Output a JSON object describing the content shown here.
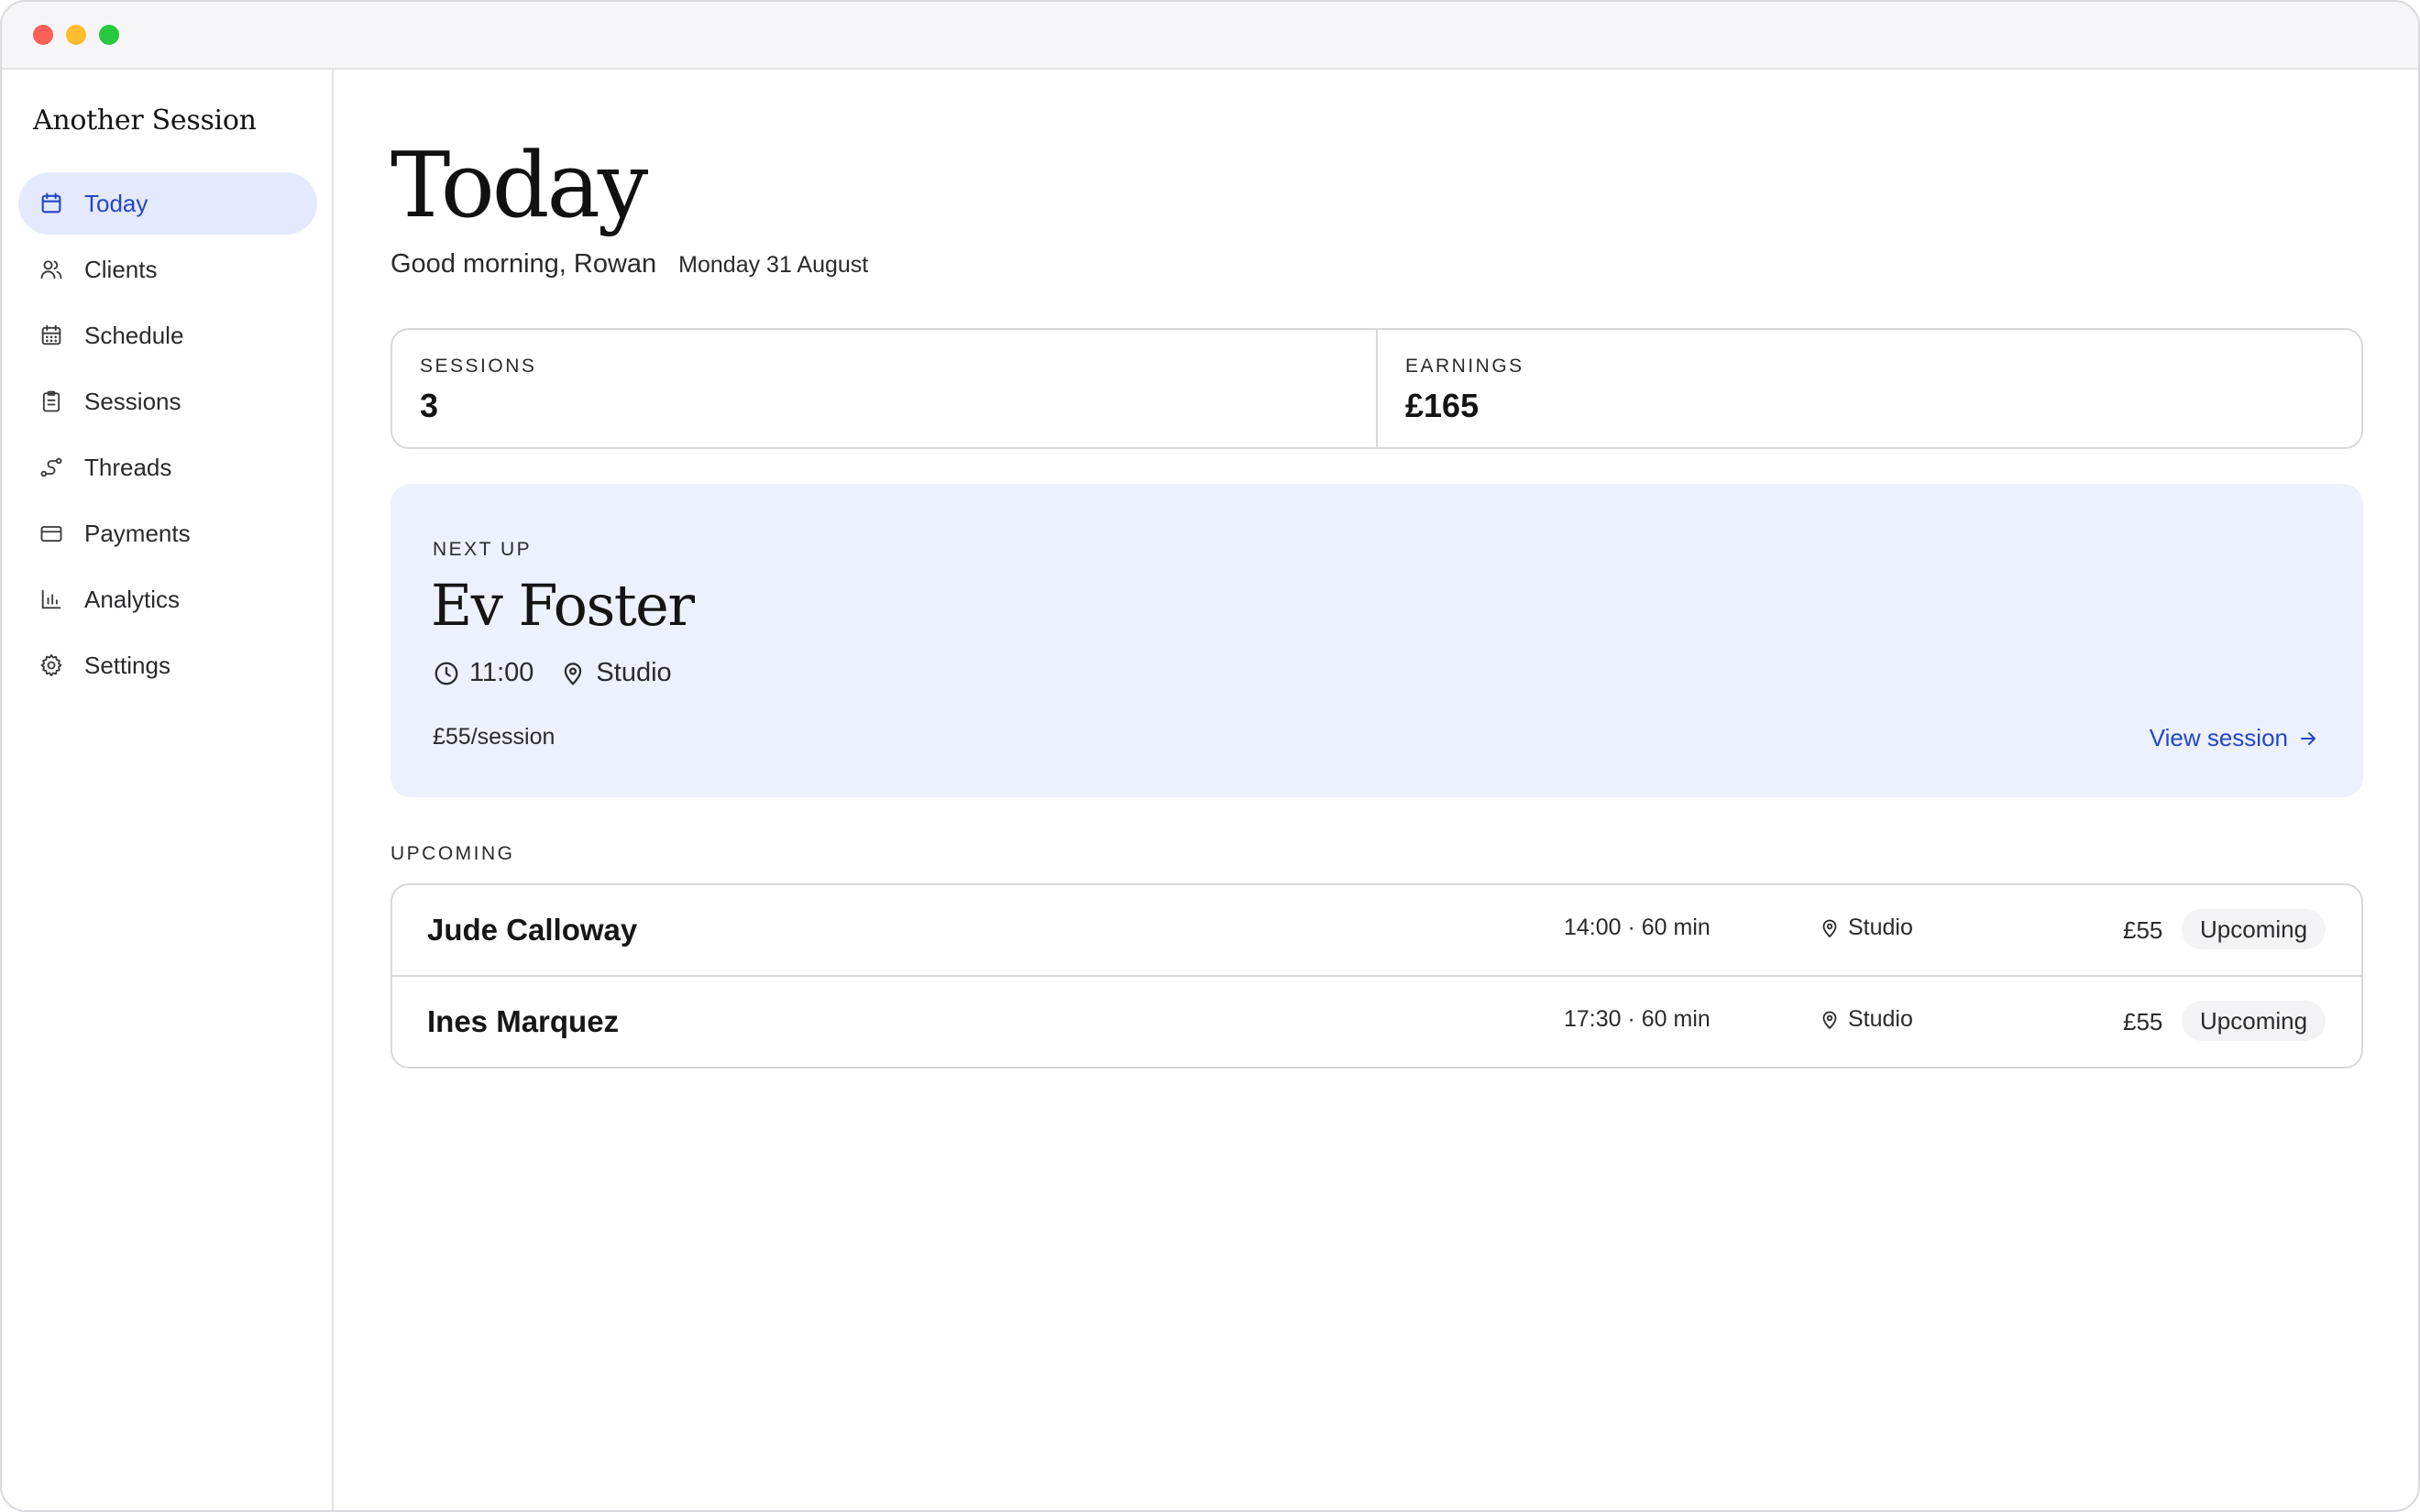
{
  "app": {
    "brand": "Another Session"
  },
  "sidebar": {
    "items": [
      {
        "label": "Today",
        "icon": "calendar-icon",
        "active": true
      },
      {
        "label": "Clients",
        "icon": "users-icon"
      },
      {
        "label": "Schedule",
        "icon": "schedule-icon"
      },
      {
        "label": "Sessions",
        "icon": "clipboard-icon"
      },
      {
        "label": "Threads",
        "icon": "threads-icon"
      },
      {
        "label": "Payments",
        "icon": "card-icon"
      },
      {
        "label": "Analytics",
        "icon": "bar-chart-icon"
      },
      {
        "label": "Settings",
        "icon": "gear-icon"
      }
    ]
  },
  "header": {
    "title": "Today",
    "greeting": "Good morning, Rowan",
    "date": "Monday 31 August"
  },
  "stats": {
    "sessions_label": "SESSIONS",
    "sessions_value": "3",
    "earnings_label": "EARNINGS",
    "earnings_value": "£165"
  },
  "next_up": {
    "label": "NEXT UP",
    "name": "Ev Foster",
    "time": "11:00",
    "location": "Studio",
    "rate": "£55/session",
    "link": "View session"
  },
  "upcoming": {
    "label": "UPCOMING",
    "rows": [
      {
        "name": "Jude Calloway",
        "time": "14:00 · 60 min",
        "location": "Studio",
        "price": "£55",
        "status": "Upcoming"
      },
      {
        "name": "Ines Marquez",
        "time": "17:30 · 60 min",
        "location": "Studio",
        "price": "£55",
        "status": "Upcoming"
      }
    ]
  },
  "colors": {
    "accent": "#2346c8",
    "active_bg": "#e5e9fd",
    "next_bg": "#edf1fd"
  }
}
